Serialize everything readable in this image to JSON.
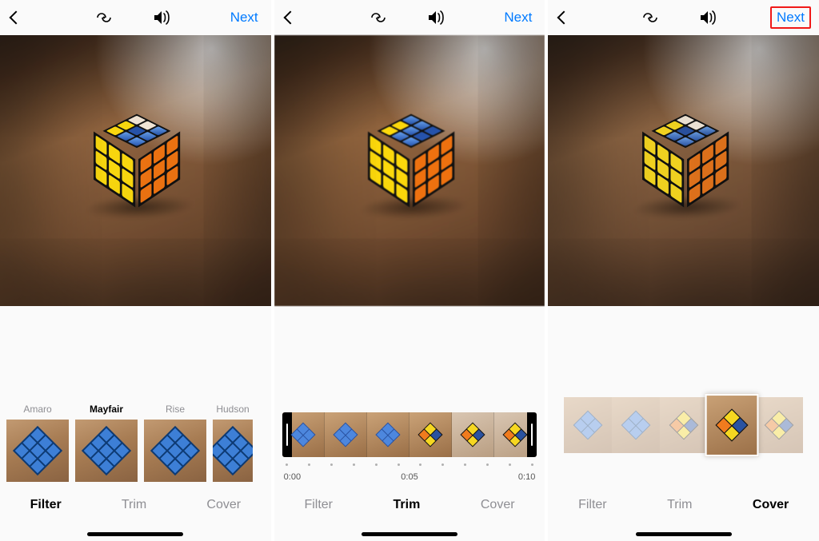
{
  "nav": {
    "next_label": "Next",
    "icons": {
      "back": "chevron-back-icon",
      "boomerang": "boomerang-icon",
      "sound": "sound-icon"
    }
  },
  "tabs": {
    "filter": "Filter",
    "trim": "Trim",
    "cover": "Cover"
  },
  "screen1": {
    "active_tab": "Filter",
    "selected_filter": "Mayfair",
    "filters": [
      {
        "name": "Amaro"
      },
      {
        "name": "Mayfair"
      },
      {
        "name": "Rise"
      },
      {
        "name": "Hudson"
      }
    ]
  },
  "screen2": {
    "active_tab": "Trim",
    "time_labels": [
      "0:00",
      "0:05",
      "0:10"
    ],
    "tick_count": 12,
    "frame_count": 6
  },
  "screen3": {
    "active_tab": "Cover",
    "next_highlighted": true,
    "thumb_count": 5,
    "selected_index": 3
  }
}
